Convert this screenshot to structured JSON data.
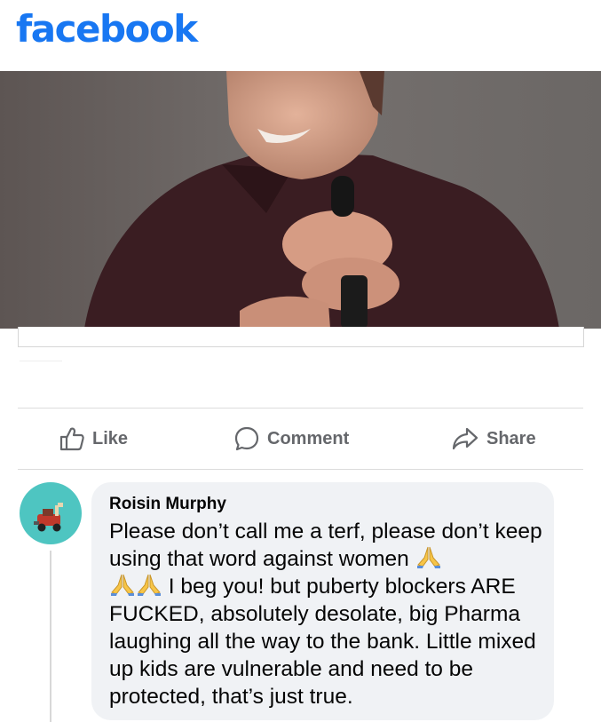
{
  "header": {
    "logo_text": "facebook",
    "brand_color": "#1877f2"
  },
  "post": {
    "photo_description_icon": "photo",
    "actions": [
      {
        "label": "Like",
        "icon": "thumbs-up-icon"
      },
      {
        "label": "Comment",
        "icon": "comment-icon"
      },
      {
        "label": "Share",
        "icon": "share-icon"
      }
    ]
  },
  "comment": {
    "author": "Roisin Murphy",
    "avatar_color": "#4ec5c1",
    "text_part1": "Please don’t call me a terf, please don’t keep using that word against women ",
    "text_part2": " I beg you! but puberty blockers ARE FUCKED, absolutely desolate, big Pharma laughing all the way to the bank. Little mixed up kids are vulnerable and need to be protected, that’s just true.",
    "emoji": "folded-hands-icon"
  }
}
